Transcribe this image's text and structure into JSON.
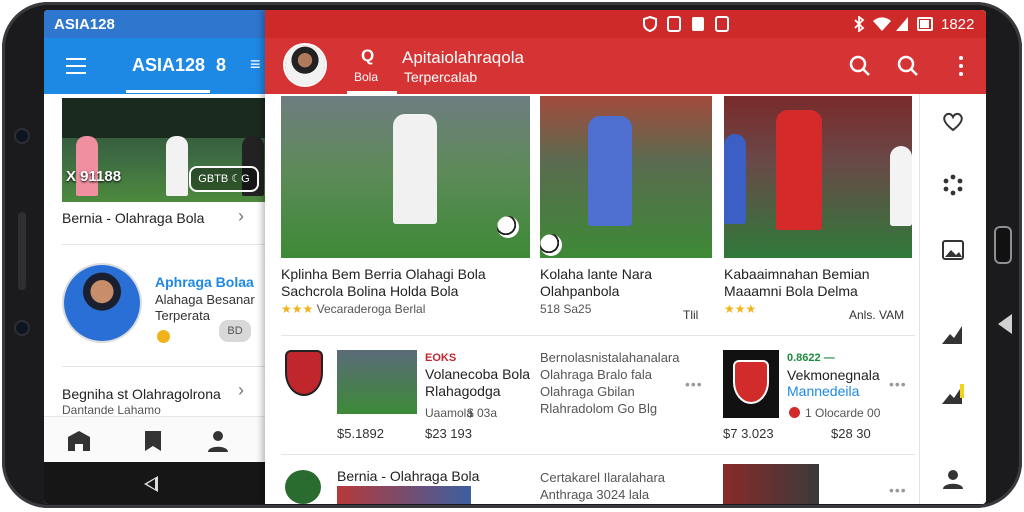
{
  "left_app": {
    "status_title": "ASIA128",
    "header": {
      "title": "ASIA128",
      "tab_symbol": "8",
      "extra_symbol": "≡"
    },
    "featured": {
      "score": "X 91188",
      "chip": "GBTB ☾G"
    },
    "row1": "Bernia - Olahraga Bola",
    "profile": {
      "name": "Aphraga Bolaa",
      "line1": "Alahaga Besanar",
      "line2": "Terperata",
      "button": "BD"
    },
    "row2": "Begniha st Olahragolrona",
    "row2_sub": "Dantande Lahamo"
  },
  "right_app": {
    "status": {
      "time": "1822"
    },
    "header": {
      "tab_icon": "Q",
      "tab_label": "Bola",
      "title": "Apitaiolahraqola",
      "subtitle": "Terpercalab"
    },
    "videos": [
      {
        "title": "Kplinha Bem Berria Olahagi Bola",
        "title2": "Sachcrola Bolina Holda Bola",
        "meta": "Vecaraderoga Berlal",
        "rating": "★★★"
      },
      {
        "title": "Kolaha lante Nara",
        "title2": "Olahpanbola",
        "meta": "518 Sa25",
        "extra": "Tlil"
      },
      {
        "title": "Kabaaimnahan Bemian",
        "title2": "Maaamni Bola Delma",
        "meta": "★★★",
        "extra": "Anls. VAM"
      }
    ],
    "list": [
      {
        "tag": "EOKS",
        "title": "Volanecoba Bola",
        "title2": "Rlahagodga",
        "sub": "Uaamola",
        "sub_val": "$ 03a",
        "price": "$5.1892",
        "price2": "$23 193",
        "desc": "Bernolasnistalahanalara",
        "desc2": "Olahraga Bralo fala",
        "desc3": "Olahraga Gbilan",
        "desc4": "Rlahradolom Go Blg"
      },
      {
        "tag": "0.8622 —",
        "title": "Vekmonegnala",
        "title2": "Mannedeila",
        "sub": "1 Olocarde 00",
        "price": "$7 3.023",
        "price2": "$28 30"
      }
    ],
    "bottom_rows": [
      {
        "title": "Bernia - Olahraga Bola"
      },
      {
        "title": "Certakarel Ilaralahara",
        "sub": "Anthraga 3024 lala"
      }
    ]
  },
  "colors": {
    "left_header": "#1e88e5",
    "right_header": "#d63434",
    "accent_star": "#f2b31a"
  },
  "icons": [
    "menu-icon",
    "search-icon",
    "more-vert-icon",
    "heart-icon",
    "loading-icon",
    "image-icon",
    "back-icon",
    "wifi-icon",
    "bluetooth-icon",
    "battery-icon"
  ]
}
